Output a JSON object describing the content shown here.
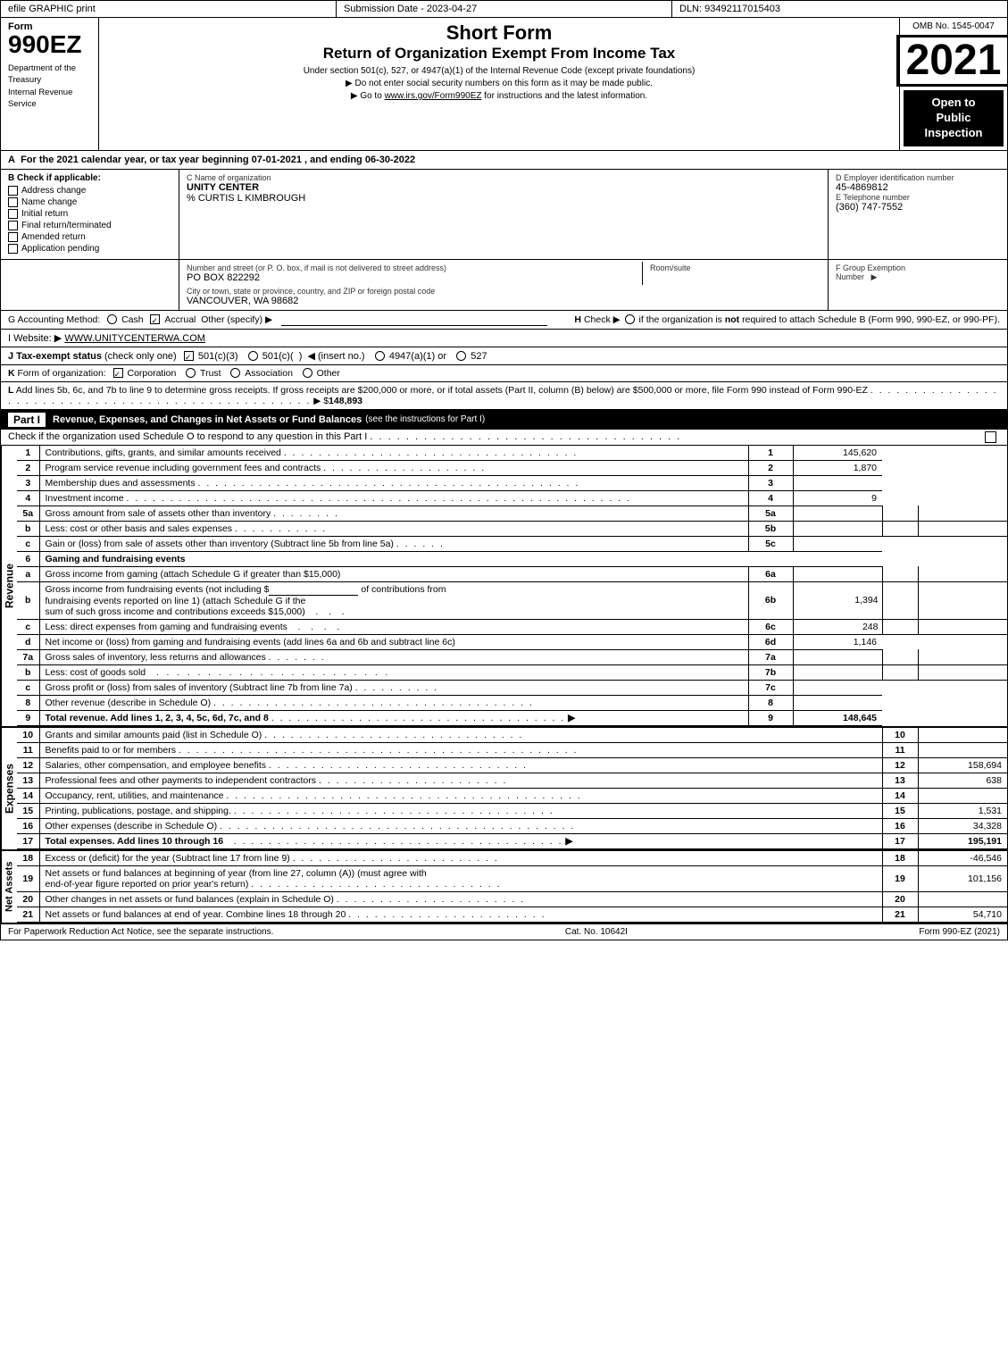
{
  "topBar": {
    "left": "efile GRAPHIC print",
    "mid": "Submission Date - 2023-04-27",
    "right": "DLN: 93492117015403"
  },
  "formNumber": "990EZ",
  "deptText": "Department of the\nTreasury\nInternal Revenue\nService",
  "titles": {
    "shortForm": "Short Form",
    "returnTitle": "Return of Organization Exempt From Income Tax",
    "subtitle": "Under section 501(c), 527, or 4947(a)(1) of the Internal Revenue Code (except private foundations)",
    "noSSN": "▶ Do not enter social security numbers on this form as it may be made public.",
    "goto": "▶ Go to www.irs.gov/Form990EZ for instructions and the latest information."
  },
  "omb": "OMB No. 1545-0047",
  "year": "2021",
  "openPublic": "Open to\nPublic\nInspection",
  "sectionA": {
    "label": "A",
    "text": "For the 2021 calendar year, or tax year beginning 07-01-2021 , and ending 06-30-2022"
  },
  "checkIfApplicable": {
    "label": "B Check if applicable:",
    "items": [
      {
        "id": "address-change",
        "label": "Address change",
        "checked": false
      },
      {
        "id": "name-change",
        "label": "Name change",
        "checked": false
      },
      {
        "id": "initial-return",
        "label": "Initial return",
        "checked": false
      },
      {
        "id": "final-return",
        "label": "Final return/terminated",
        "checked": false
      },
      {
        "id": "amended-return",
        "label": "Amended return",
        "checked": false
      },
      {
        "id": "application-pending",
        "label": "Application pending",
        "checked": false
      }
    ]
  },
  "orgInfo": {
    "nameLabel": "C Name of organization",
    "name": "UNITY CENTER",
    "careofLabel": "% CURTIS L KIMBROUGH",
    "addressLabel": "Number and street (or P. O. box, if mail is not delivered to street address)",
    "address": "PO BOX 822292",
    "roomSuiteLabel": "Room/suite",
    "cityLabel": "City or town, state or province, country, and ZIP or foreign postal code",
    "city": "VANCOUVER, WA  98682"
  },
  "ein": {
    "label": "D Employer identification number",
    "value": "45-4869812",
    "phoneLabel": "E Telephone number",
    "phone": "(360) 747-7552",
    "groupLabel": "F Group Exemption\nNumber",
    "groupArrow": "▶"
  },
  "website": {
    "label": "I Website:",
    "arrow": "▶",
    "url": "WWW.UNITYCENTERWA.COM"
  },
  "taxExempt": {
    "label": "J Tax-exempt status",
    "checkNote": "(check only one)",
    "status501c3": "☑ 501(c)(3)",
    "status501c": "○ 501(c)(  )",
    "insertNo": "◀ (insert no.)",
    "status4947": "○ 4947(a)(1) or",
    "status527": "○ 527"
  },
  "kRow": {
    "label": "K Form of organization:",
    "corporation": "☑ Corporation",
    "trust": "○ Trust",
    "association": "○ Association",
    "other": "○ Other"
  },
  "lRow": {
    "text": "L Add lines 5b, 6c, and 7b to line 9 to determine gross receipts. If gross receipts are $200,000 or more, or if total assets (Part II, column (B) below) are $500,000 or more, file Form 990 instead of Form 990-EZ",
    "dots": ". . . . . . . . . . . . . . . . . . . . . . . . . . . . . . . . . . . . . . . . . . . . . . . . . . . .",
    "arrow": "▶ $",
    "value": "148,893"
  },
  "acctMethod": {
    "label": "G Accounting Method:",
    "cash": "○ Cash",
    "accrual": "☑ Accrual",
    "other": "Other (specify) ▶",
    "hLabel": "H",
    "hCheck": "Check ▶",
    "hText": "○ if the organization is not required to attach Schedule B (Form 990, 990-EZ, or 990-PF)."
  },
  "partI": {
    "header": "Part I",
    "headerText": "Revenue, Expenses, and Changes in Net Assets or Fund Balances",
    "headerNote": "(see the instructions for Part I)",
    "checkLine": "Check if the organization used Schedule O to respond to any question in this Part I",
    "checkDots": ". . . . . . . . . . . . . . . . . . . . . . . . . . .",
    "lines": [
      {
        "num": "1",
        "desc": "Contributions, gifts, grants, and similar amounts received",
        "dots": ". . . . . . . . . . . . . . . . . . . . . . . . . . . . . . . . . .",
        "ref": "1",
        "amount": "145,620",
        "shaded": false
      },
      {
        "num": "2",
        "desc": "Program service revenue including government fees and contracts",
        "dots": ". . . . . . . . . . . . . . . . . .",
        "ref": "2",
        "amount": "1,870",
        "shaded": false
      },
      {
        "num": "3",
        "desc": "Membership dues and assessments",
        "dots": ". . . . . . . . . . . . . . . . . . . . . . . . . . . . . . . . . . . . . . . . . . . .",
        "ref": "3",
        "amount": "",
        "shaded": false
      },
      {
        "num": "4",
        "desc": "Investment income",
        "dots": ". . . . . . . . . . . . . . . . . . . . . . . . . . . . . . . . . . . . . . . . . . . . . . . . . . . . . . . . . .",
        "ref": "4",
        "amount": "9",
        "shaded": false
      },
      {
        "num": "5a",
        "desc": "Gross amount from sale of assets other than inventory",
        "dots": ". . . . . . . .",
        "sub": "5a",
        "subAmount": "",
        "ref": "",
        "amount": "",
        "shaded": false,
        "hasSub": true
      },
      {
        "num": "b",
        "desc": "Less: cost or other basis and sales expenses",
        "dots": ". . . . . . . . . . .",
        "sub": "5b",
        "subAmount": "",
        "ref": "",
        "amount": "",
        "shaded": false,
        "hasSub": true
      },
      {
        "num": "c",
        "desc": "Gain or (loss) from sale of assets other than inventory (Subtract line 5b from line 5a)",
        "dots": ". . . . . .",
        "ref": "5c",
        "amount": "",
        "shaded": false
      },
      {
        "num": "6",
        "desc": "Gaming and fundraising events",
        "dots": "",
        "ref": "",
        "amount": "",
        "shaded": false,
        "isHeader": true
      }
    ]
  },
  "revenueLines": [
    {
      "num": "a",
      "desc": "Gross income from gaming (attach Schedule G if greater than $15,000)",
      "sub": "6a",
      "subAmount": "",
      "ref": "",
      "amount": ""
    },
    {
      "num": "b",
      "desc": "Gross income from fundraising events (not including $____________ of contributions from fundraising events reported on line 1) (attach Schedule G if the sum of such gross income and contributions exceeds $15,000)",
      "sub": "6b",
      "subAmount": "1,394",
      "ref": "",
      "amount": ""
    },
    {
      "num": "c",
      "desc": "Less: direct expenses from gaming and fundraising events",
      "dots": ". . . .",
      "sub": "6c",
      "subAmount": "248",
      "ref": "",
      "amount": ""
    },
    {
      "num": "d",
      "desc": "Net income or (loss) from gaming and fundraising events (add lines 6a and 6b and subtract line 6c)",
      "ref": "6d",
      "amount": "1,146"
    },
    {
      "num": "7a",
      "desc": "Gross sales of inventory, less returns and allowances",
      "dots": ". . . . . . .",
      "sub": "7a",
      "subAmount": "",
      "ref": "",
      "amount": ""
    },
    {
      "num": "b",
      "desc": "Less: cost of goods sold",
      "dots": ". . . . . . . . . . . . . . . . . . . . . . . .",
      "sub": "7b",
      "subAmount": "",
      "ref": "",
      "amount": ""
    },
    {
      "num": "c",
      "desc": "Gross profit or (loss) from sales of inventory (Subtract line 7b from line 7a)",
      "dots": ". . . . . . . . . .",
      "ref": "7c",
      "amount": ""
    },
    {
      "num": "8",
      "desc": "Other revenue (describe in Schedule O)",
      "dots": ". . . . . . . . . . . . . . . . . . . . . . . . . . . . . . . . . . . . .",
      "ref": "8",
      "amount": ""
    },
    {
      "num": "9",
      "desc": "Total revenue. Add lines 1, 2, 3, 4, 5c, 6d, 7c, and 8",
      "dots": ". . . . . . . . . . . . . . . . . . . . . . . . . . . . . . . . . . .",
      "arrow": "▶",
      "ref": "9",
      "amount": "148,645",
      "bold": true
    }
  ],
  "expenseLines": [
    {
      "num": "10",
      "desc": "Grants and similar amounts paid (list in Schedule O)",
      "dots": ". . . . . . . . . . . . . . . . . . . . . . . . . . . . . .",
      "ref": "10",
      "amount": ""
    },
    {
      "num": "11",
      "desc": "Benefits paid to or for members",
      "dots": ". . . . . . . . . . . . . . . . . . . . . . . . . . . . . . . . . . . . . . . . . . . . . .",
      "ref": "11",
      "amount": ""
    },
    {
      "num": "12",
      "desc": "Salaries, other compensation, and employee benefits",
      "dots": ". . . . . . . . . . . . . . . . . . . . . . . . . . . . . .",
      "ref": "12",
      "amount": "158,694"
    },
    {
      "num": "13",
      "desc": "Professional fees and other payments to independent contractors",
      "dots": ". . . . . . . . . . . . . . . . . . . . . .",
      "ref": "13",
      "amount": "638"
    },
    {
      "num": "14",
      "desc": "Occupancy, rent, utilities, and maintenance",
      "dots": ". . . . . . . . . . . . . . . . . . . . . . . . . . . . . . . . . . . . . . . . .",
      "ref": "14",
      "amount": ""
    },
    {
      "num": "15",
      "desc": "Printing, publications, postage, and shipping.",
      "dots": ". . . . . . . . . . . . . . . . . . . . . . . . . . . . . . . . . . . . . .",
      "ref": "15",
      "amount": "1,531"
    },
    {
      "num": "16",
      "desc": "Other expenses (describe in Schedule O)",
      "dots": ". . . . . . . . . . . . . . . . . . . . . . . . . . . . . . . . . . . . . . . . .",
      "ref": "16",
      "amount": "34,328"
    },
    {
      "num": "17",
      "desc": "Total expenses. Add lines 10 through 16",
      "dots": ". . . . . . . . . . . . . . . . . . . . . . . . . . . . . . . . . . . . . .",
      "arrow": "▶",
      "ref": "17",
      "amount": "195,191",
      "bold": true
    }
  ],
  "netAssetLines": [
    {
      "num": "18",
      "desc": "Excess or (deficit) for the year (Subtract line 17 from line 9)",
      "dots": ". . . . . . . . . . . . . . . . . . . . . . . .",
      "ref": "18",
      "amount": "-46,546"
    },
    {
      "num": "19",
      "desc": "Net assets or fund balances at beginning of year (from line 27, column (A)) (must agree with end-of-year figure reported on prior year's return)",
      "dots": ". . . . . . . . . . . . . . . . . . . . . . . . . . . . .",
      "ref": "19",
      "amount": "101,156"
    },
    {
      "num": "20",
      "desc": "Other changes in net assets or fund balances (explain in Schedule O)",
      "dots": ". . . . . . . . . . . . . . . . . . . . . .",
      "ref": "20",
      "amount": ""
    },
    {
      "num": "21",
      "desc": "Net assets or fund balances at end of year. Combine lines 18 through 20",
      "dots": ". . . . . . . . . . . . . . . . . . . . . . .",
      "ref": "21",
      "amount": "54,710"
    }
  ],
  "footer": {
    "left": "For Paperwork Reduction Act Notice, see the separate instructions.",
    "mid": "Cat. No. 10642I",
    "right": "Form 990-EZ (2021)"
  }
}
